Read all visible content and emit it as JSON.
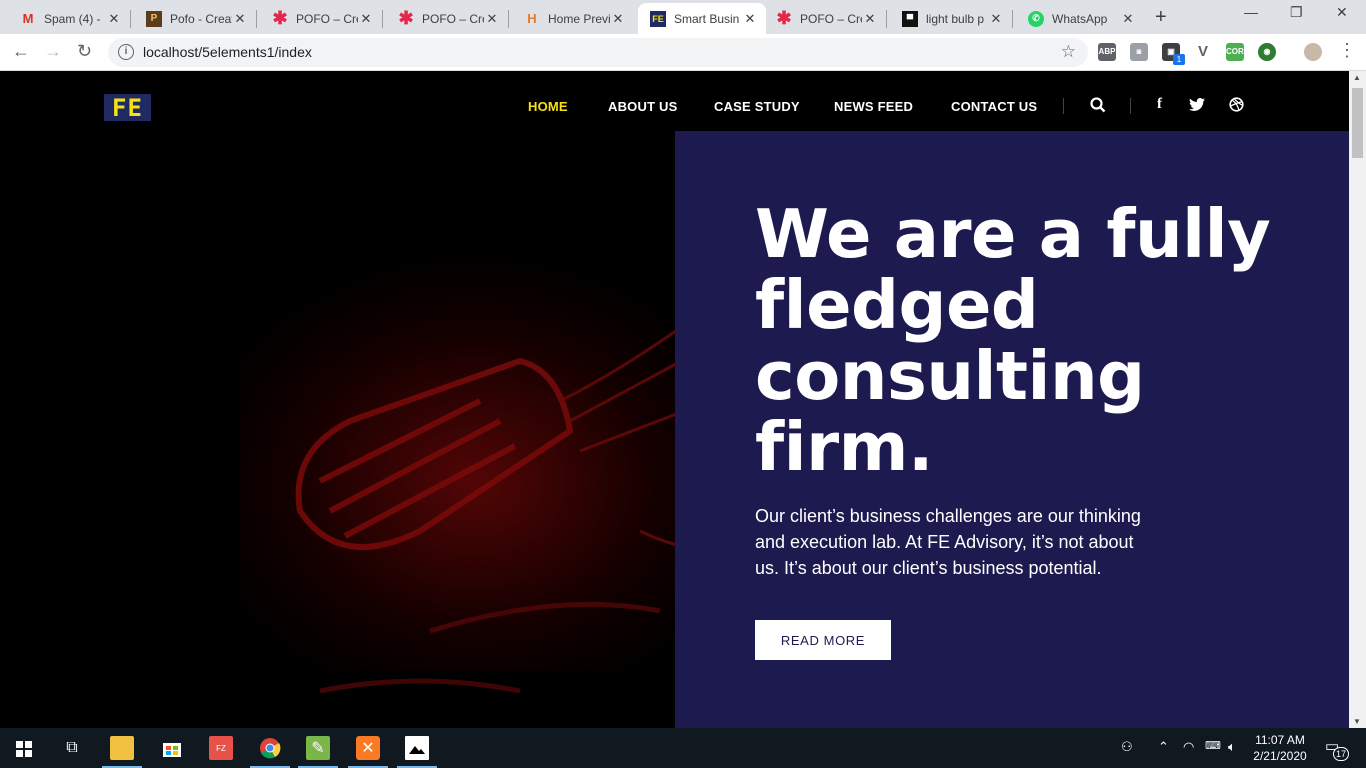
{
  "browser": {
    "tabs": [
      {
        "title": "Spam (4) - ",
        "favicon": "gmail-icon",
        "active": false
      },
      {
        "title": "Pofo - Creat",
        "favicon": "pofo-icon",
        "active": false
      },
      {
        "title": "POFO – Cre",
        "favicon": "asterisk-icon",
        "active": false
      },
      {
        "title": "POFO – Cre",
        "favicon": "asterisk-icon",
        "active": false
      },
      {
        "title": "Home Previ",
        "favicon": "h-icon",
        "active": false
      },
      {
        "title": "Smart Busin",
        "favicon": "fe-icon",
        "active": true
      },
      {
        "title": "POFO – Cre",
        "favicon": "asterisk-icon",
        "active": false
      },
      {
        "title": "light bulb p",
        "favicon": "unsplash-icon",
        "active": false
      },
      {
        "title": "WhatsApp",
        "favicon": "whatsapp-icon",
        "active": false
      }
    ],
    "url": "localhost/5elements1/index",
    "extension_badge": "1"
  },
  "site": {
    "logo_text": "FE",
    "nav": {
      "home": "HOME",
      "about": "ABOUT US",
      "case_study": "CASE STUDY",
      "news_feed": "NEWS FEED",
      "contact": "CONTACT US"
    },
    "hero": {
      "headline": "We are a fully fledged consulting firm.",
      "lead": "Our client’s business challenges are our thinking and execution lab. At FE Advisory, it’s not about us. It’s about our client’s business potential.",
      "cta": "READ MORE"
    },
    "colors": {
      "accent": "#f6e112",
      "panel": "#1e1b52",
      "background": "#000000"
    }
  },
  "taskbar": {
    "time": "11:07 AM",
    "date": "2/21/2020",
    "notifications": "17"
  }
}
